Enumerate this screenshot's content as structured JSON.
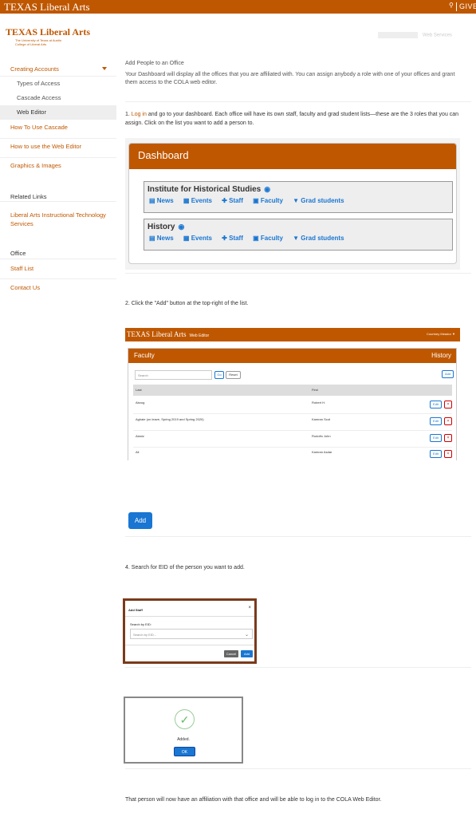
{
  "topbar": {
    "brand": "TEXAS  Liberal Arts",
    "search_icon": "⚲",
    "give": "GIVE"
  },
  "logo": {
    "name": "TEXAS Liberal Arts",
    "sub1": "The University of Texas at Austin",
    "sub2": "College of Liberal Arts"
  },
  "web_services": "Web Services",
  "sidebar": {
    "items": [
      {
        "label": "Creating Accounts"
      },
      {
        "label": "Types of Access"
      },
      {
        "label": "Cascade Access"
      },
      {
        "label": "Web Editor"
      },
      {
        "label": "How To Use Cascade"
      },
      {
        "label": "How to use the Web Editor"
      },
      {
        "label": "Graphics & Images"
      }
    ],
    "related_heading": "Related Links",
    "related_links": [
      {
        "label": "Liberal Arts Instructional Technology Services"
      }
    ],
    "office_heading": "Office",
    "office_links": [
      {
        "label": "Staff List"
      },
      {
        "label": "Contact Us"
      }
    ]
  },
  "main": {
    "heading": "Add People to an Office",
    "intro": "Your Dashboard will display all the offices that you are affiliated with. You can assign anybody a role with one of your offices and grant them access to the COLA web editor.",
    "step1_link": "Log in",
    "step1_text": " and go to your dashboard. Each office will have its own staff, faculty and grad student lists—these are the 3 roles that you can assign. Click on the list you want to add a person to.",
    "step1_prefix": "1. ",
    "step2": "2. Click the \"Add\" button at the top-right of the list.",
    "step4": "4. Search for EID of the person you want to add.",
    "final": "That person will now have an affiliation with that office and will be able to log in to the COLA Web Editor."
  },
  "dashboard": {
    "title": "Dashboard",
    "offices": [
      {
        "name": "Institute for Historical Studies"
      },
      {
        "name": "History"
      }
    ],
    "links": [
      "News",
      "Events",
      "Staff",
      "Faculty",
      "Grad students"
    ]
  },
  "screenshot2": {
    "brand": "TEXAS Liberal Arts",
    "web_editor": "Web Editor",
    "user": "Courtney Meador ▼",
    "panel_title": "Faculty",
    "panel_office": "History",
    "search_placeholder": "Search",
    "go": "Go",
    "reset": "Reset",
    "add": "Add",
    "col_last": "Last",
    "col_first": "First",
    "rows": [
      {
        "last": "Abzug",
        "first": "Robert H."
      },
      {
        "last": "Aghaie (on leave, Spring 2019 and Spring 2020)",
        "first": "Kamran Scot"
      },
      {
        "last": "Alaniz",
        "first": "Rodolfo John"
      },
      {
        "last": "Ali",
        "first": "Kamran Asdar"
      }
    ],
    "edit": "Edit",
    "delete": "×"
  },
  "add_button": "Add",
  "modal": {
    "title": "Add Staff",
    "close": "×",
    "label": "Search by EID:",
    "placeholder": "Search by EID...",
    "cancel": "Cancel",
    "add": "Add"
  },
  "added_dialog": {
    "message": "Added.",
    "ok": "OK"
  }
}
